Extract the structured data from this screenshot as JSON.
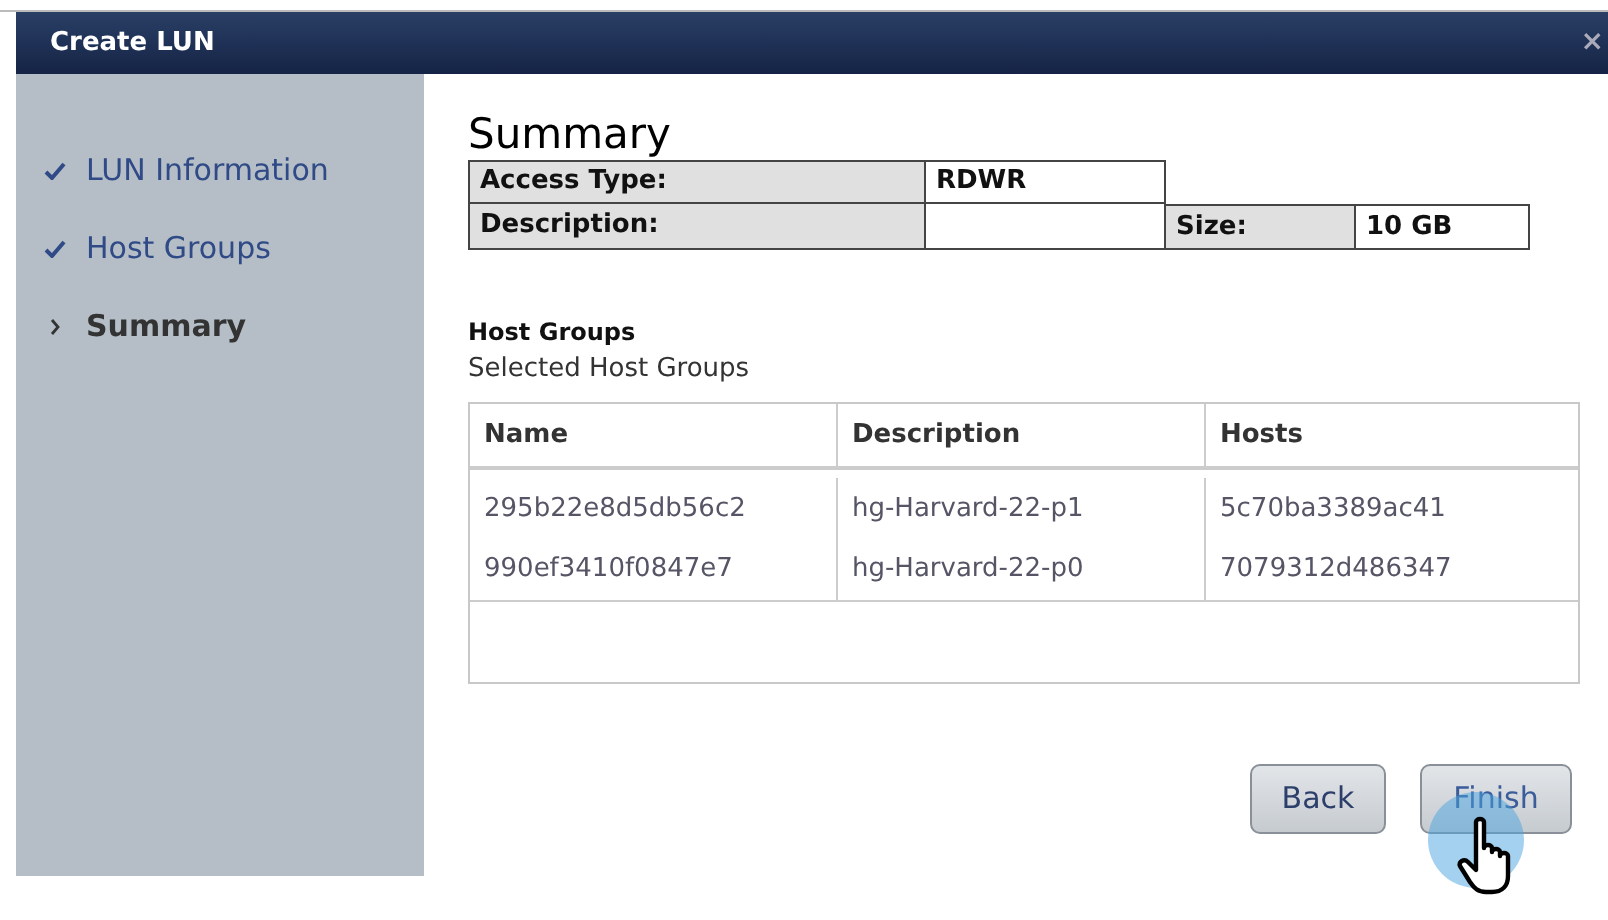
{
  "window": {
    "title": "Create LUN",
    "close": "×"
  },
  "steps": [
    {
      "label": "LUN Information",
      "kind": "done",
      "selected": false
    },
    {
      "label": "Host Groups",
      "kind": "done",
      "selected": false
    },
    {
      "label": "Summary",
      "kind": "current",
      "selected": true
    }
  ],
  "summary": {
    "heading": "Summary",
    "access_type_label": "Access Type:",
    "access_type": "RDWR",
    "description_label": "Description:",
    "size_label": "Size:",
    "size": "10 GB"
  },
  "host_groups": {
    "heading": "Host Groups",
    "subheading": "Selected Host Groups",
    "columns": [
      "Name",
      "Description",
      "Hosts"
    ],
    "rows": [
      [
        "295b22e8d5db56c2",
        "hg-Harvard-22-p1",
        "5c70ba3389ac41"
      ],
      [
        "990ef3410f0847e7",
        "hg-Harvard-22-p0",
        "7079312d486347"
      ]
    ]
  },
  "buttons": [
    {
      "label": "Back",
      "hovered": false
    },
    {
      "label": "Finish",
      "hovered": true
    }
  ]
}
